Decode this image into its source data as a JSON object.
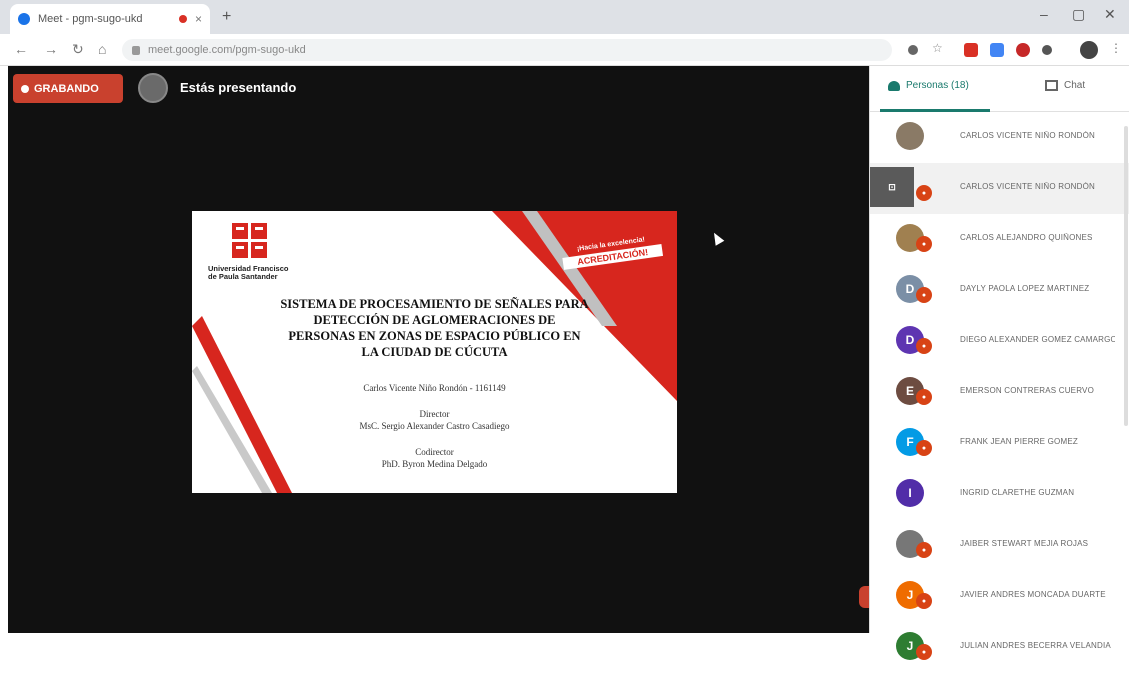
{
  "browser": {
    "tab_title": "Meet - pgm-sugo-ukd",
    "address": "meet.google.com/pgm-sugo-ukd",
    "new_tab_symbol": "+",
    "close_symbol": "×",
    "controls": {
      "minimize": "–",
      "maximize": "▢",
      "close": "✕"
    },
    "nav": {
      "back": "←",
      "forward": "→",
      "reload": "↻",
      "home": "⌂"
    }
  },
  "meet": {
    "recording_label": "GRABANDO",
    "presenting_label": "Estás presentando"
  },
  "slide": {
    "university": "Universidad Francisco de Paula Santander",
    "accreditation_top": "¡Hacia la excelencia!",
    "accreditation_main": "ACREDITACIÓN!",
    "title_lines": [
      "SISTEMA DE PROCESAMIENTO DE SEÑALES PARA",
      "DETECCIÓN DE AGLOMERACIONES DE",
      "PERSONAS EN ZONAS DE ESPACIO PÚBLICO EN",
      "LA CIUDAD DE CÚCUTA"
    ],
    "author": "Carlos Vicente Niño Rondón - 1161149",
    "director_label": "Director",
    "director_name": "MsC. Sergio Alexander Castro Casadiego",
    "codirector_label": "Codirector",
    "codirector_name": "PhD. Byron Medina Delgado"
  },
  "panel": {
    "people_tab": "Personas (18)",
    "chat_tab": "Chat",
    "participants": [
      {
        "name": "CARLOS VICENTE NIÑO RONDÓN",
        "initial": "",
        "color": "#8a7a66",
        "kind": "photo"
      },
      {
        "name": "CARLOS VICENTE NIÑO RONDÓN",
        "initial": "⊡",
        "color": "#5a5a5a",
        "kind": "screen"
      },
      {
        "name": "CARLOS ALEJANDRO QUIÑONES",
        "initial": "",
        "color": "#a08050",
        "kind": "photo"
      },
      {
        "name": "DAYLY PAOLA LOPEZ MARTINEZ",
        "initial": "D",
        "color": "#7b8fa6",
        "kind": "letter"
      },
      {
        "name": "DIEGO ALEXANDER GOMEZ CAMARGO",
        "initial": "D",
        "color": "#5e35b1",
        "kind": "letter"
      },
      {
        "name": "EMERSON CONTRERAS CUERVO",
        "initial": "E",
        "color": "#6d4c41",
        "kind": "letter"
      },
      {
        "name": "FRANK JEAN PIERRE GOMEZ",
        "initial": "F",
        "color": "#039be5",
        "kind": "letter"
      },
      {
        "name": "INGRID CLARETHE GUZMAN",
        "initial": "I",
        "color": "#512da8",
        "kind": "letter"
      },
      {
        "name": "JAIBER STEWART MEJIA ROJAS",
        "initial": "",
        "color": "#777777",
        "kind": "photo"
      },
      {
        "name": "JAVIER ANDRES MONCADA DUARTE",
        "initial": "J",
        "color": "#ef6c00",
        "kind": "letter"
      },
      {
        "name": "JULIAN ANDRES BECERRA VELANDIA",
        "initial": "J",
        "color": "#2e7d32",
        "kind": "letter"
      }
    ]
  }
}
